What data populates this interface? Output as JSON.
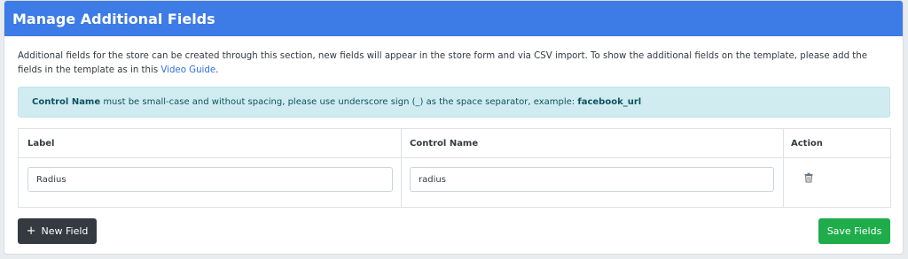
{
  "header": {
    "title": "Manage Additional Fields"
  },
  "intro": {
    "text": "Additional fields for the store can be created through this section, new fields will appear in the store form and via CSV import. To show the additional fields on the template, please add the fields in the template as in this ",
    "link": "Video Guide",
    "suffix": "."
  },
  "notice": {
    "strong": "Control Name",
    "text": " must be small-case and without spacing, please use underscore sign (_) as the space separator, example: ",
    "example": "facebook_url"
  },
  "table": {
    "columns": [
      "Label",
      "Control Name",
      "Action"
    ],
    "rows": [
      {
        "label": "Radius",
        "control_name": "radius",
        "action_icon": "trash-icon"
      }
    ]
  },
  "buttons": {
    "new_field": "New Field",
    "new_field_icon": "plus-icon",
    "save_fields": "Save Fields"
  },
  "colors": {
    "header": "#3d7be6",
    "notice_bg": "#d1ecf1",
    "new_button": "#343a40",
    "save_button": "#1ead4a",
    "link": "#2f6fdb"
  }
}
